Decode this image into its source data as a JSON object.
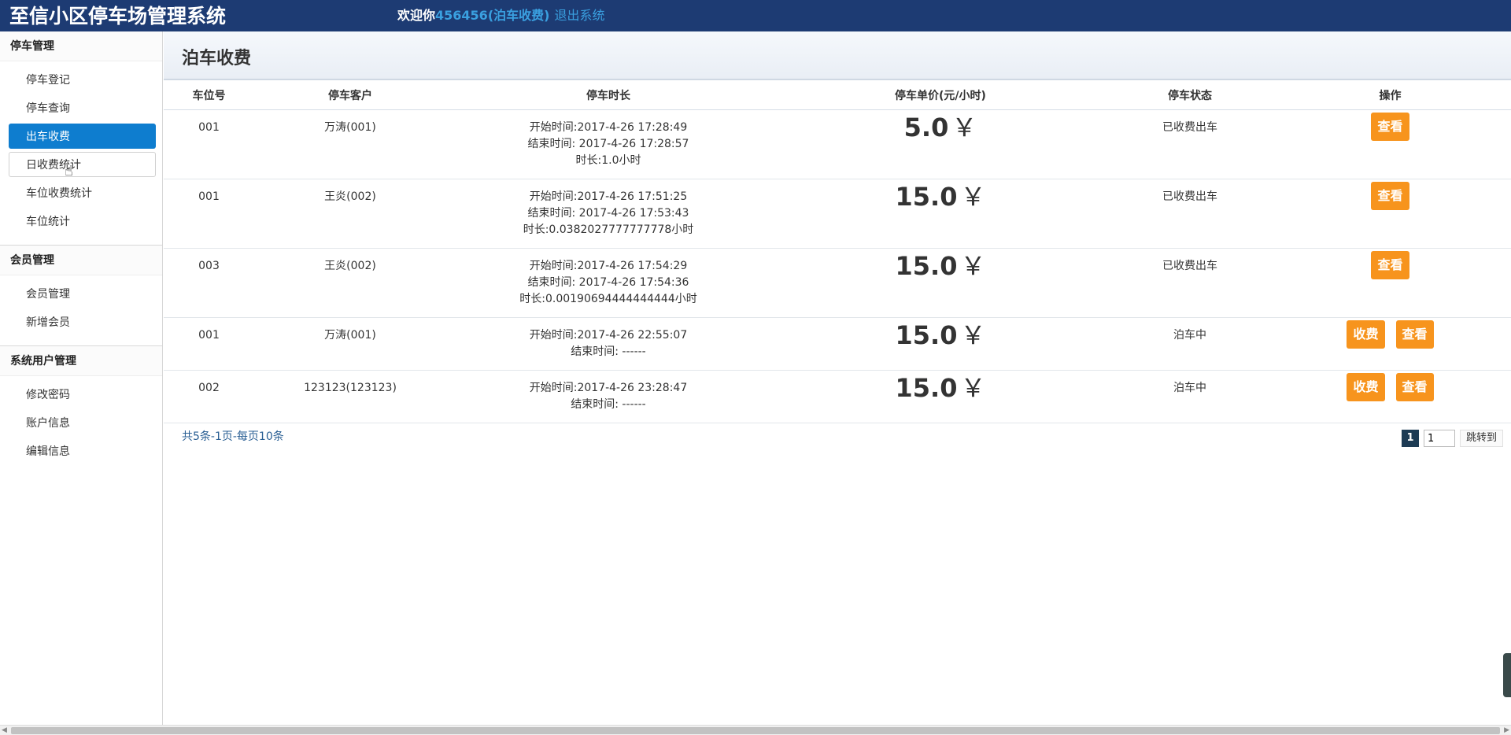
{
  "header": {
    "app_title": "至信小区停车场管理系统",
    "welcome_prefix": "欢迎你",
    "user": "456456(泊车收费)",
    "logout_label": "退出系统"
  },
  "sidebar": {
    "groups": [
      {
        "title": "停车管理",
        "items": [
          {
            "label": "停车登记"
          },
          {
            "label": "停车查询"
          },
          {
            "label": "出车收费",
            "active": true
          },
          {
            "label": "日收费统计",
            "hovered": true
          },
          {
            "label": "车位收费统计"
          },
          {
            "label": "车位统计"
          }
        ]
      },
      {
        "title": "会员管理",
        "items": [
          {
            "label": "会员管理"
          },
          {
            "label": "新增会员"
          }
        ]
      },
      {
        "title": "系统用户管理",
        "items": [
          {
            "label": "修改密码"
          },
          {
            "label": "账户信息"
          },
          {
            "label": "编辑信息"
          }
        ]
      }
    ]
  },
  "main": {
    "page_title": "泊车收费",
    "table": {
      "columns": [
        "车位号",
        "停车客户",
        "停车时长",
        "停车单价(元/小时)",
        "停车状态",
        "操作"
      ],
      "rows": [
        {
          "space": "001",
          "customer": "万涛(001)",
          "start": "开始时间:2017-4-26 17:28:49",
          "end": "结束时间: 2017-4-26 17:28:57",
          "duration": "时长:1.0小时",
          "price": "5.0",
          "status": "已收费出车",
          "actions": [
            "查看"
          ]
        },
        {
          "space": "001",
          "customer": "王炎(002)",
          "start": "开始时间:2017-4-26 17:51:25",
          "end": "结束时间: 2017-4-26 17:53:43",
          "duration": "时长:0.0382027777777778小时",
          "price": "15.0",
          "status": "已收费出车",
          "actions": [
            "查看"
          ]
        },
        {
          "space": "003",
          "customer": "王炎(002)",
          "start": "开始时间:2017-4-26 17:54:29",
          "end": "结束时间: 2017-4-26 17:54:36",
          "duration": "时长:0.00190694444444444小时",
          "price": "15.0",
          "status": "已收费出车",
          "actions": [
            "查看"
          ]
        },
        {
          "space": "001",
          "customer": "万涛(001)",
          "start": "开始时间:2017-4-26 22:55:07",
          "end": "结束时间: ------",
          "duration": "",
          "price": "15.0",
          "status": "泊车中",
          "actions": [
            "收费",
            "查看"
          ]
        },
        {
          "space": "002",
          "customer": "123123(123123)",
          "start": "开始时间:2017-4-26 23:28:47",
          "end": "结束时间: ------",
          "duration": "",
          "price": "15.0",
          "status": "泊车中",
          "actions": [
            "收费",
            "查看"
          ]
        }
      ],
      "currency_symbol": "￥"
    },
    "pager": {
      "summary": "共5条-1页-每页10条",
      "current_page": "1",
      "input_value": "1",
      "go_label": "跳转到"
    }
  }
}
